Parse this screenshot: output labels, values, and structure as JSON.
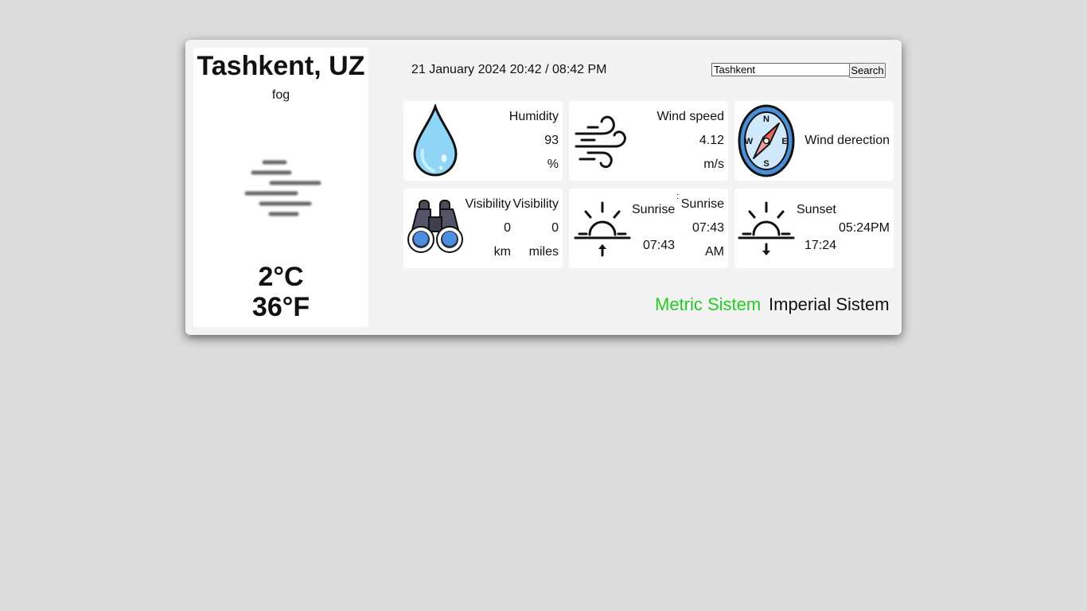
{
  "location": {
    "city": "Tashkent, UZ",
    "description": "fog",
    "weather_icon": "fog-icon",
    "temp_c": "2°C",
    "temp_f": "36°F"
  },
  "header": {
    "datetime": "21 January 2024 20:42 / 08:42 PM",
    "search_value": "Tashkent",
    "search_button": "Search"
  },
  "cards": {
    "humidity": {
      "icon": "water-drop-icon",
      "label": "Humidity",
      "value": "93",
      "unit": "%"
    },
    "wind_speed": {
      "icon": "wind-icon",
      "label": "Wind speed",
      "value": "4.12",
      "unit": "m/s"
    },
    "wind_direction": {
      "icon": "compass-icon",
      "label": "Wind derection",
      "compass": {
        "n": "N",
        "s": "S",
        "e": "E",
        "w": "W"
      }
    },
    "visibility": {
      "icon": "binoculars-icon",
      "label_km": "Visibility",
      "value_km": "0",
      "unit_km": "km",
      "label_miles": "Visibility",
      "value_miles": "0",
      "unit_miles": "miles"
    },
    "sunrise": {
      "icon": "sunrise-icon",
      "label": "Sunrise",
      "time_24": "07:43",
      "mark": ":",
      "label_12": "Sunrise",
      "time_12": "07:43",
      "ampm": "AM"
    },
    "sunset": {
      "icon": "sunset-icon",
      "label": "Sunset",
      "time_12": "05:24PM",
      "time_24": "17:24"
    }
  },
  "unit_switch": {
    "metric": "Metric Sistem",
    "imperial": "Imperial Sistem",
    "active_color": "#22cc22"
  }
}
